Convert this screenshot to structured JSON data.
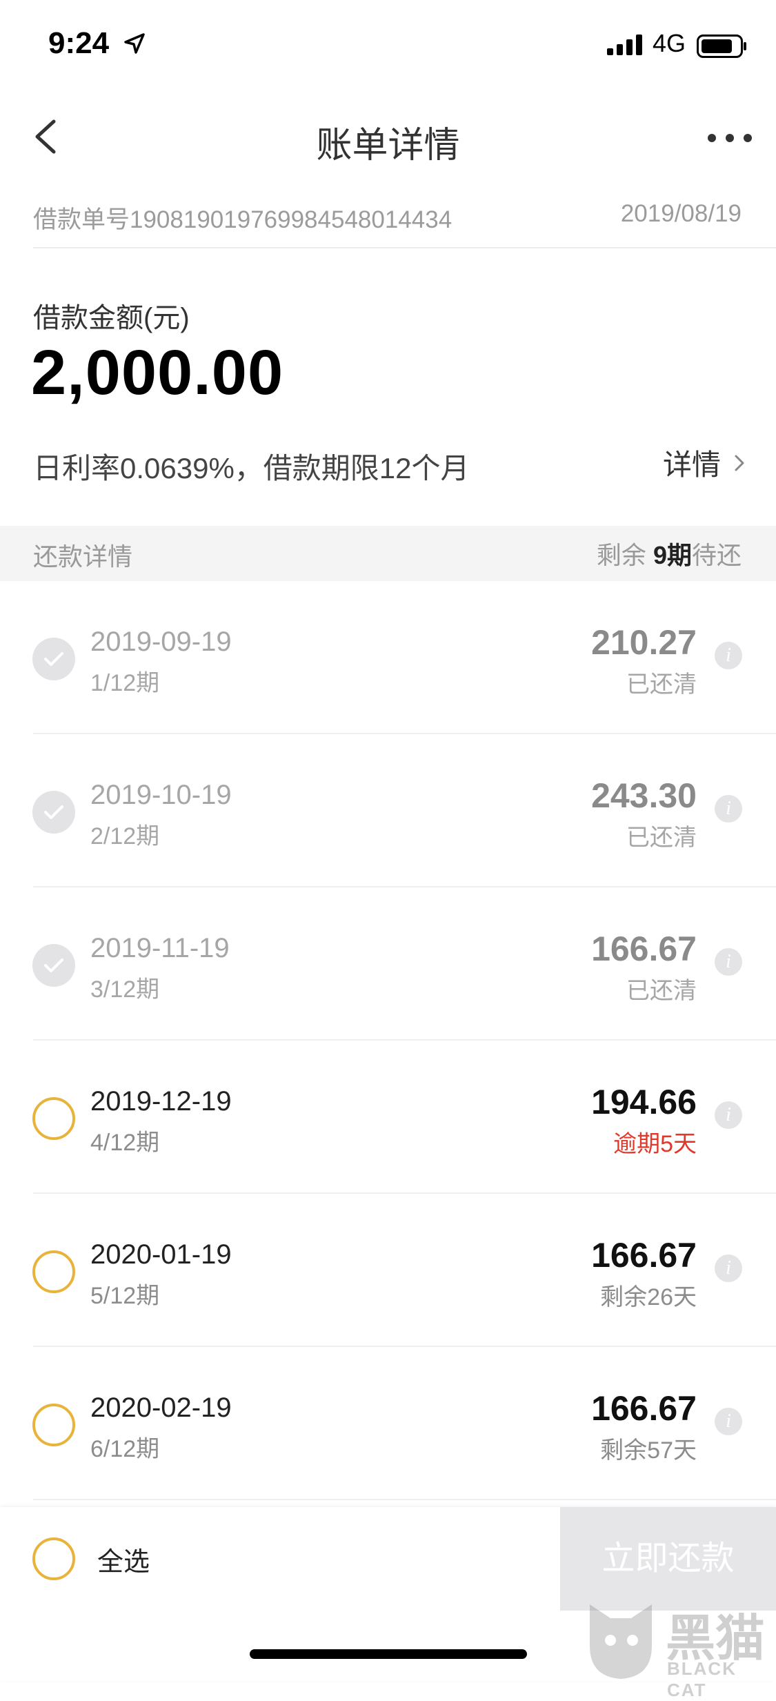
{
  "status_bar": {
    "time": "9:24",
    "network": "4G",
    "icons": [
      "location-arrow-icon",
      "signal-icon",
      "battery-icon"
    ]
  },
  "nav": {
    "back_icon": "chevron-left-icon",
    "title": "账单详情",
    "more_icon": "more-dots-icon"
  },
  "loan": {
    "number": "借款单号190819019769984548014434",
    "date": "2019/08/19",
    "amount_label": "借款金额(元)",
    "amount": "2,000.00",
    "rate_text": "日利率0.0639%，借款期限12个月",
    "detail_label": "详情"
  },
  "repayment": {
    "title": "还款详情",
    "remain_prefix": "剩余",
    "remain_count": "9期",
    "remain_suffix": "待还",
    "rows": [
      {
        "date": "2019-09-19",
        "period": "1/12期",
        "amount": "210.27",
        "state": "已还清",
        "status": "paid"
      },
      {
        "date": "2019-10-19",
        "period": "2/12期",
        "amount": "243.30",
        "state": "已还清",
        "status": "paid"
      },
      {
        "date": "2019-11-19",
        "period": "3/12期",
        "amount": "166.67",
        "state": "已还清",
        "status": "paid"
      },
      {
        "date": "2019-12-19",
        "period": "4/12期",
        "amount": "194.66",
        "state": "逾期5天",
        "status": "overdue"
      },
      {
        "date": "2020-01-19",
        "period": "5/12期",
        "amount": "166.67",
        "state": "剩余26天",
        "status": "pending"
      },
      {
        "date": "2020-02-19",
        "period": "6/12期",
        "amount": "166.67",
        "state": "剩余57天",
        "status": "pending"
      }
    ]
  },
  "bottom": {
    "select_all": "全选",
    "pay_button": "立即还款"
  },
  "watermark": {
    "text": "黑猫",
    "sub": "BLACK CAT"
  },
  "colors": {
    "accent_circle": "#e8b33a",
    "overdue": "#e0392b",
    "disabled_button": "#e6e6e8"
  }
}
